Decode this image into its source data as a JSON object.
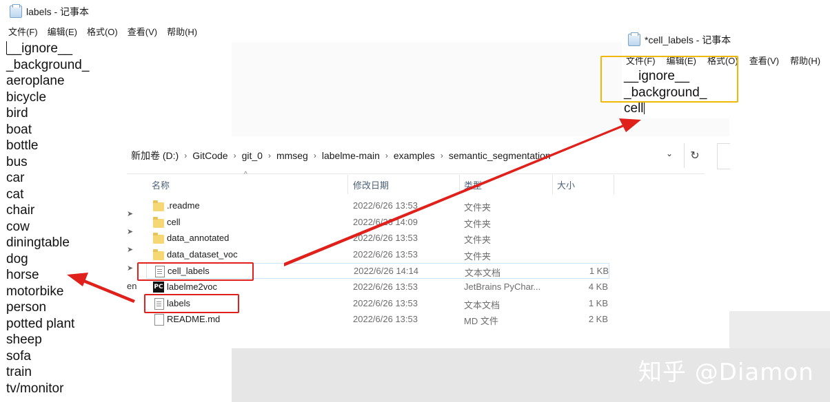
{
  "left_notepad": {
    "title": "labels - 记事本",
    "menu": [
      "文件(F)",
      "编辑(E)",
      "格式(O)",
      "查看(V)",
      "帮助(H)"
    ],
    "lines": [
      "__ignore__",
      "_background_",
      "aeroplane",
      "bicycle",
      "bird",
      "boat",
      "bottle",
      "bus",
      "car",
      "cat",
      "chair",
      "cow",
      "diningtable",
      "dog",
      "horse",
      "motorbike",
      "person",
      "potted plant",
      "sheep",
      "sofa",
      "train",
      "tv/monitor"
    ]
  },
  "right_notepad": {
    "title": "*cell_labels - 记事本",
    "menu": [
      "文件(F)",
      "编辑(E)",
      "格式(O)",
      "查看(V)",
      "帮助(H)"
    ],
    "lines": [
      "__ignore__",
      "_background_",
      "cell"
    ]
  },
  "explorer": {
    "breadcrumb": [
      "新加卷 (D:)",
      "GitCode",
      "git_0",
      "mmseg",
      "labelme-main",
      "examples",
      "semantic_segmentation"
    ],
    "columns": {
      "name": "名称",
      "date": "修改日期",
      "type": "类型",
      "size": "大小"
    },
    "sidebar_fragment": "en",
    "files": [
      {
        "name": ".readme",
        "date": "2022/6/26 13:53",
        "type": "文件夹",
        "size": "",
        "icon": "folder-icon"
      },
      {
        "name": "cell",
        "date": "2022/6/26 14:09",
        "type": "文件夹",
        "size": "",
        "icon": "folder-icon"
      },
      {
        "name": "data_annotated",
        "date": "2022/6/26 13:53",
        "type": "文件夹",
        "size": "",
        "icon": "folder-icon"
      },
      {
        "name": "data_dataset_voc",
        "date": "2022/6/26 13:53",
        "type": "文件夹",
        "size": "",
        "icon": "folder-icon"
      },
      {
        "name": "cell_labels",
        "date": "2022/6/26 14:14",
        "type": "文本文档",
        "size": "1 KB",
        "icon": "text-file-icon"
      },
      {
        "name": "labelme2voc",
        "date": "2022/6/26 13:53",
        "type": "JetBrains PyChar...",
        "size": "4 KB",
        "icon": "pycharm-file-icon"
      },
      {
        "name": "labels",
        "date": "2022/6/26 13:53",
        "type": "文本文档",
        "size": "1 KB",
        "icon": "text-file-icon"
      },
      {
        "name": "README.md",
        "date": "2022/6/26 13:53",
        "type": "MD 文件",
        "size": "2 KB",
        "icon": "md-file-icon"
      }
    ]
  },
  "watermark": "知乎 @Diamon",
  "colors": {
    "annotation_red": "#e0201b",
    "highlight_yellow": "#f2b705",
    "selection_border": "#cce4f7"
  }
}
